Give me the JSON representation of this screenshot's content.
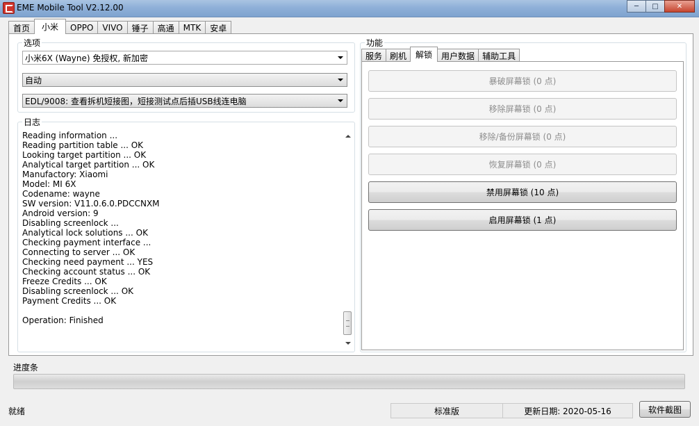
{
  "window": {
    "title": "EME Mobile Tool V2.12.00",
    "minimize_glyph": "─",
    "maximize_glyph": "□",
    "close_glyph": "✕"
  },
  "main_tabs": [
    {
      "label": "首页",
      "active": false
    },
    {
      "label": "小米",
      "active": true
    },
    {
      "label": "OPPO",
      "active": false
    },
    {
      "label": "VIVO",
      "active": false
    },
    {
      "label": "锤子",
      "active": false
    },
    {
      "label": "高通",
      "active": false
    },
    {
      "label": "MTK",
      "active": false
    },
    {
      "label": "安卓",
      "active": false
    }
  ],
  "options": {
    "label": "选项",
    "model_select": "小米6X (Wayne) 免授权, 新加密",
    "mode_select": "自动",
    "edl_select": "EDL/9008: 查看拆机短接图，短接测试点后插USB线连电脑"
  },
  "log": {
    "label": "日志",
    "lines": [
      "Reading information ...",
      "Reading partition table ... OK",
      "Looking target partition ... OK",
      "Analytical target partition ... OK",
      "Manufactory: Xiaomi",
      "Model: MI 6X",
      "Codename: wayne",
      "SW version: V11.0.6.0.PDCCNXM",
      "Android version: 9",
      "Disabling screenlock ...",
      "Analytical lock solutions ... OK",
      "Checking payment interface ...",
      "Connecting to server ... OK",
      "Checking need payment ... YES",
      "Checking account status ... OK",
      "Freeze Credits ... OK",
      "Disabling screenlock ... OK",
      "Payment Credits ... OK",
      "",
      "Operation: Finished"
    ]
  },
  "functions": {
    "label": "功能",
    "tabs": [
      {
        "label": "服务",
        "active": false
      },
      {
        "label": "刷机",
        "active": false
      },
      {
        "label": "解锁",
        "active": true
      },
      {
        "label": "用户数据",
        "active": false
      },
      {
        "label": "辅助工具",
        "active": false
      }
    ],
    "buttons": [
      {
        "label": "暴破屏幕锁 (0 点)",
        "enabled": false
      },
      {
        "label": "移除屏幕锁 (0 点)",
        "enabled": false
      },
      {
        "label": "移除/备份屏幕锁 (0 点)",
        "enabled": false
      },
      {
        "label": "恢复屏幕锁 (0 点)",
        "enabled": false
      },
      {
        "label": "禁用屏幕锁 (10 点)",
        "enabled": true
      },
      {
        "label": "启用屏幕锁 (1 点)",
        "enabled": true
      }
    ]
  },
  "progress": {
    "label": "进度条",
    "value": 0
  },
  "status": {
    "text": "就绪",
    "edition": "标准版",
    "update_date": "更新日期: 2020-05-16",
    "screenshot_button": "软件截图"
  }
}
